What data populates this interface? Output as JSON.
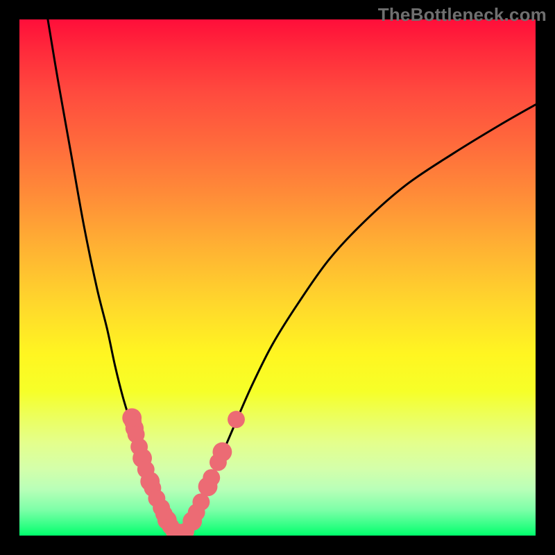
{
  "watermark": "TheBottleneck.com",
  "chart_data": {
    "type": "line",
    "title": "",
    "xlabel": "",
    "ylabel": "",
    "xlim": [
      0,
      100
    ],
    "ylim": [
      0,
      100
    ],
    "left_curve": {
      "x": [
        5.5,
        7.5,
        10.0,
        12.5,
        15.0,
        17.0,
        18.5,
        20.0,
        21.5,
        23.0,
        24.5,
        26.0,
        27.5,
        29.0,
        30.2
      ],
      "y": [
        100.0,
        88.0,
        74.0,
        60.0,
        48.0,
        40.0,
        33.0,
        27.0,
        22.0,
        17.0,
        13.0,
        9.0,
        5.5,
        2.5,
        0.5
      ]
    },
    "right_curve": {
      "x": [
        32.3,
        34.0,
        36.0,
        38.5,
        41.5,
        45.0,
        49.0,
        54.0,
        60.0,
        67.0,
        75.0,
        84.0,
        93.0,
        100.0
      ],
      "y": [
        0.5,
        3.5,
        8.0,
        14.0,
        21.0,
        29.0,
        37.0,
        45.0,
        53.5,
        61.0,
        68.0,
        74.0,
        79.5,
        83.5
      ]
    },
    "floor": {
      "x": [
        30.2,
        31.0,
        31.8,
        32.3
      ],
      "y": [
        0.5,
        0.0,
        0.0,
        0.5
      ]
    },
    "dots": [
      {
        "x": 21.8,
        "y": 22.8,
        "r": 1.2
      },
      {
        "x": 22.0,
        "y": 22.0,
        "r": 1.0
      },
      {
        "x": 22.3,
        "y": 20.8,
        "r": 1.1
      },
      {
        "x": 22.6,
        "y": 19.6,
        "r": 1.0
      },
      {
        "x": 23.2,
        "y": 17.2,
        "r": 1.0
      },
      {
        "x": 23.8,
        "y": 15.0,
        "r": 1.2
      },
      {
        "x": 24.5,
        "y": 12.8,
        "r": 1.0
      },
      {
        "x": 25.3,
        "y": 10.5,
        "r": 1.2
      },
      {
        "x": 25.8,
        "y": 9.2,
        "r": 1.0
      },
      {
        "x": 26.6,
        "y": 7.2,
        "r": 1.0
      },
      {
        "x": 27.5,
        "y": 5.4,
        "r": 1.0
      },
      {
        "x": 28.0,
        "y": 4.2,
        "r": 1.0
      },
      {
        "x": 28.6,
        "y": 3.0,
        "r": 1.2
      },
      {
        "x": 29.3,
        "y": 1.8,
        "r": 1.0
      },
      {
        "x": 30.0,
        "y": 0.8,
        "r": 1.0
      },
      {
        "x": 30.5,
        "y": 0.5,
        "r": 1.2
      },
      {
        "x": 31.5,
        "y": 0.4,
        "r": 1.2
      },
      {
        "x": 32.2,
        "y": 0.8,
        "r": 1.0
      },
      {
        "x": 33.5,
        "y": 2.8,
        "r": 1.2
      },
      {
        "x": 34.3,
        "y": 4.5,
        "r": 1.0
      },
      {
        "x": 35.2,
        "y": 6.5,
        "r": 1.0
      },
      {
        "x": 36.5,
        "y": 9.5,
        "r": 1.2
      },
      {
        "x": 37.2,
        "y": 11.2,
        "r": 1.0
      },
      {
        "x": 38.5,
        "y": 14.2,
        "r": 1.0
      },
      {
        "x": 39.3,
        "y": 16.2,
        "r": 1.2
      },
      {
        "x": 42.0,
        "y": 22.5,
        "r": 1.0
      }
    ],
    "background_gradient": {
      "top": "#ff0e3a",
      "mid1": "#ff8c38",
      "mid2": "#fff621",
      "bottom": "#00ff6c"
    }
  }
}
